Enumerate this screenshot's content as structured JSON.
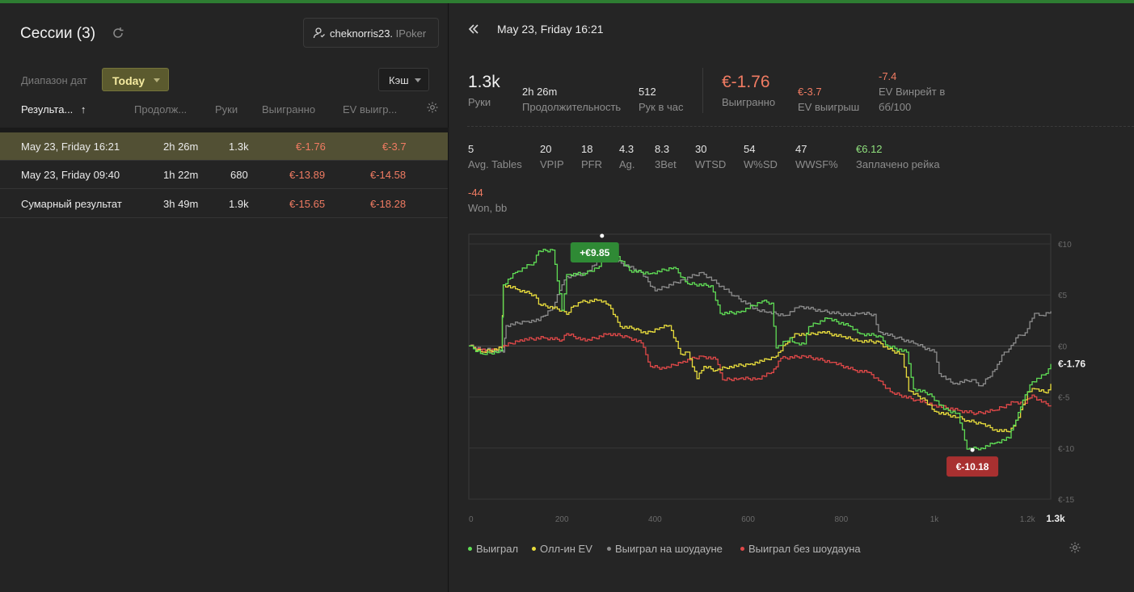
{
  "sessions": {
    "title": "Сессии (3)",
    "user": {
      "name": "cheknorris23.",
      "room": "IPoker"
    },
    "date_range_label": "Диапазон дат",
    "date_range_value": "Today",
    "game_type": "Кэш",
    "columns": [
      "Результа...",
      "Продолж...",
      "Руки",
      "Выигранно",
      "EV выигр..."
    ],
    "rows": [
      {
        "date": "May 23, Friday 16:21",
        "duration": "2h 26m",
        "hands": "1.3k",
        "won": "€-1.76",
        "ev": "€-3.7",
        "selected": true
      },
      {
        "date": "May 23, Friday 09:40",
        "duration": "1h 22m",
        "hands": "680",
        "won": "€-13.89",
        "ev": "€-14.58",
        "selected": false
      },
      {
        "date": "Сумарный результат",
        "duration": "3h 49m",
        "hands": "1.9k",
        "won": "€-15.65",
        "ev": "€-18.28",
        "selected": false
      }
    ]
  },
  "detail": {
    "date": "May 23, Friday 16:21",
    "stats1": {
      "hands_value": "1.3k",
      "hands_label": "Руки",
      "duration_value": "2h 26m",
      "duration_label": "Продолжительность",
      "per_hour_value": "512",
      "per_hour_label": "Рук в час",
      "won_value": "€-1.76",
      "won_label": "Выигранно",
      "ev_value": "€-3.7",
      "ev_label": "EV выигрыш",
      "evbb_value": "-7.4",
      "evbb_label": "EV Винрейт в",
      "evbb_label2": "бб/100"
    },
    "stats2": [
      {
        "value": "5",
        "label": "Avg. Tables",
        "tone": "normal"
      },
      {
        "value": "20",
        "label": "VPIP",
        "tone": "normal"
      },
      {
        "value": "18",
        "label": "PFR",
        "tone": "normal"
      },
      {
        "value": "4.3",
        "label": "Ag.",
        "tone": "normal"
      },
      {
        "value": "8.3",
        "label": "3Bet",
        "tone": "normal"
      },
      {
        "value": "30",
        "label": "WTSD",
        "tone": "normal"
      },
      {
        "value": "54",
        "label": "W%SD",
        "tone": "normal"
      },
      {
        "value": "47",
        "label": "WWSF%",
        "tone": "normal"
      },
      {
        "value": "€6.12",
        "label": "Заплачено рейка",
        "tone": "pos"
      }
    ],
    "stats3": {
      "value": "-44",
      "label": "Won, bb"
    },
    "legend": [
      {
        "name": "Выиграл",
        "color": "#5fdc55"
      },
      {
        "name": "Олл-ин EV",
        "color": "#e8dc3c"
      },
      {
        "name": "Выиграл на шоудауне",
        "color": "#8c8c8c"
      },
      {
        "name": "Выиграл без шоудауна",
        "color": "#e04848"
      }
    ]
  },
  "chart_data": {
    "type": "line",
    "x_ticks": [
      "0",
      "200",
      "400",
      "600",
      "800",
      "1k",
      "1.2k",
      "1.3k"
    ],
    "y_ticks": [
      "€10",
      "€5",
      "€0",
      "€-5",
      "€-10",
      "€-15"
    ],
    "ylim": [
      -15,
      10
    ],
    "xlim": [
      0,
      1250
    ],
    "max_label": "+€9.85",
    "min_label": "€-10.18",
    "end_label": "€-1.76",
    "series": [
      {
        "name": "Выиграл",
        "color": "#5fdc55",
        "points": [
          [
            0,
            0
          ],
          [
            30,
            -0.8
          ],
          [
            70,
            -0.5
          ],
          [
            74,
            6.0
          ],
          [
            100,
            7.2
          ],
          [
            140,
            8.2
          ],
          [
            150,
            9.3
          ],
          [
            180,
            9.4
          ],
          [
            200,
            3.5
          ],
          [
            210,
            7.0
          ],
          [
            250,
            7.1
          ],
          [
            280,
            7.8
          ],
          [
            300,
            9.85
          ],
          [
            345,
            7.4
          ],
          [
            390,
            7.1
          ],
          [
            440,
            7.7
          ],
          [
            470,
            6.1
          ],
          [
            520,
            5.9
          ],
          [
            540,
            3.2
          ],
          [
            580,
            3.3
          ],
          [
            630,
            4.4
          ],
          [
            650,
            4.2
          ],
          [
            660,
            -0.2
          ],
          [
            690,
            0.8
          ],
          [
            700,
            0.3
          ],
          [
            720,
            0.2
          ],
          [
            730,
            1.9
          ],
          [
            770,
            2.7
          ],
          [
            820,
            1.9
          ],
          [
            840,
            1.2
          ],
          [
            880,
            1.0
          ],
          [
            900,
            0.0
          ],
          [
            940,
            -0.6
          ],
          [
            955,
            -4.2
          ],
          [
            990,
            -4.7
          ],
          [
            1020,
            -6.2
          ],
          [
            1050,
            -6.6
          ],
          [
            1070,
            -10.1
          ],
          [
            1100,
            -10.0
          ],
          [
            1130,
            -9.5
          ],
          [
            1160,
            -9.0
          ],
          [
            1180,
            -6.5
          ],
          [
            1190,
            -5.3
          ],
          [
            1210,
            -3.5
          ],
          [
            1240,
            -2.7
          ],
          [
            1250,
            -1.76
          ]
        ]
      },
      {
        "name": "Олл-ин EV",
        "color": "#e8dc3c",
        "points": [
          [
            0,
            0
          ],
          [
            30,
            -0.6
          ],
          [
            70,
            -0.2
          ],
          [
            74,
            6.0
          ],
          [
            100,
            5.6
          ],
          [
            140,
            5.0
          ],
          [
            150,
            4.1
          ],
          [
            200,
            3.5
          ],
          [
            210,
            3.1
          ],
          [
            220,
            3.8
          ],
          [
            240,
            4.3
          ],
          [
            280,
            4.5
          ],
          [
            300,
            4.0
          ],
          [
            325,
            1.9
          ],
          [
            360,
            1.7
          ],
          [
            380,
            1.2
          ],
          [
            410,
            1.8
          ],
          [
            430,
            2.0
          ],
          [
            455,
            -0.8
          ],
          [
            470,
            -0.6
          ],
          [
            490,
            -3.2
          ],
          [
            505,
            -2.0
          ],
          [
            530,
            -2.4
          ],
          [
            560,
            -2.0
          ],
          [
            600,
            -1.8
          ],
          [
            630,
            -1.5
          ],
          [
            650,
            -1.1
          ],
          [
            660,
            -1.0
          ],
          [
            690,
            0.8
          ],
          [
            700,
            1.2
          ],
          [
            730,
            1.1
          ],
          [
            760,
            1.4
          ],
          [
            800,
            0.9
          ],
          [
            840,
            0.5
          ],
          [
            880,
            0.4
          ],
          [
            900,
            -0.3
          ],
          [
            930,
            -0.8
          ],
          [
            945,
            -4.4
          ],
          [
            980,
            -5.3
          ],
          [
            1000,
            -6.4
          ],
          [
            1050,
            -7.0
          ],
          [
            1070,
            -7.3
          ],
          [
            1100,
            -7.6
          ],
          [
            1130,
            -8.2
          ],
          [
            1160,
            -8.4
          ],
          [
            1180,
            -7.0
          ],
          [
            1200,
            -4.5
          ],
          [
            1215,
            -4.2
          ],
          [
            1240,
            -4.6
          ],
          [
            1250,
            -3.7
          ]
        ]
      },
      {
        "name": "Выиграл на шоудауне",
        "color": "#8c8c8c",
        "points": [
          [
            0,
            0
          ],
          [
            30,
            -0.3
          ],
          [
            74,
            -0.6
          ],
          [
            80,
            2.0
          ],
          [
            120,
            2.4
          ],
          [
            150,
            2.5
          ],
          [
            180,
            3.8
          ],
          [
            200,
            6.0
          ],
          [
            210,
            6.8
          ],
          [
            250,
            7.1
          ],
          [
            290,
            8.9
          ],
          [
            370,
            7.2
          ],
          [
            400,
            5.4
          ],
          [
            460,
            6.5
          ],
          [
            500,
            7.2
          ],
          [
            570,
            4.9
          ],
          [
            620,
            3.5
          ],
          [
            640,
            3.3
          ],
          [
            680,
            3.0
          ],
          [
            710,
            3.9
          ],
          [
            760,
            3.4
          ],
          [
            820,
            3.0
          ],
          [
            840,
            3.2
          ],
          [
            870,
            3.1
          ],
          [
            880,
            1.4
          ],
          [
            920,
            0.8
          ],
          [
            960,
            0.2
          ],
          [
            1000,
            -0.6
          ],
          [
            1010,
            -2.7
          ],
          [
            1040,
            -3.7
          ],
          [
            1080,
            -3.3
          ],
          [
            1100,
            -3.9
          ],
          [
            1130,
            -2.3
          ],
          [
            1150,
            -0.6
          ],
          [
            1160,
            -0.3
          ],
          [
            1175,
            0.8
          ],
          [
            1195,
            1.3
          ],
          [
            1215,
            3.2
          ],
          [
            1230,
            3.0
          ],
          [
            1250,
            3.4
          ]
        ]
      },
      {
        "name": "Выиграл без шоудауна",
        "color": "#e04848",
        "points": [
          [
            0,
            0
          ],
          [
            40,
            -0.6
          ],
          [
            70,
            -0.1
          ],
          [
            110,
            0.6
          ],
          [
            160,
            0.8
          ],
          [
            200,
            0.6
          ],
          [
            210,
            1.2
          ],
          [
            250,
            0.5
          ],
          [
            300,
            1.2
          ],
          [
            340,
            0.9
          ],
          [
            370,
            0.3
          ],
          [
            390,
            -2.0
          ],
          [
            420,
            -2.2
          ],
          [
            460,
            -1.5
          ],
          [
            500,
            -1.0
          ],
          [
            530,
            -1.3
          ],
          [
            545,
            -3.3
          ],
          [
            580,
            -3.2
          ],
          [
            620,
            -3.2
          ],
          [
            650,
            -2.6
          ],
          [
            670,
            -1.2
          ],
          [
            720,
            -1.0
          ],
          [
            780,
            -1.6
          ],
          [
            830,
            -2.4
          ],
          [
            860,
            -2.6
          ],
          [
            880,
            -3.4
          ],
          [
            910,
            -4.6
          ],
          [
            960,
            -5.3
          ],
          [
            1000,
            -5.8
          ],
          [
            1050,
            -6.3
          ],
          [
            1090,
            -6.6
          ],
          [
            1130,
            -6.3
          ],
          [
            1170,
            -5.5
          ],
          [
            1190,
            -5.7
          ],
          [
            1210,
            -4.8
          ],
          [
            1230,
            -5.5
          ],
          [
            1250,
            -5.8
          ]
        ]
      }
    ]
  }
}
